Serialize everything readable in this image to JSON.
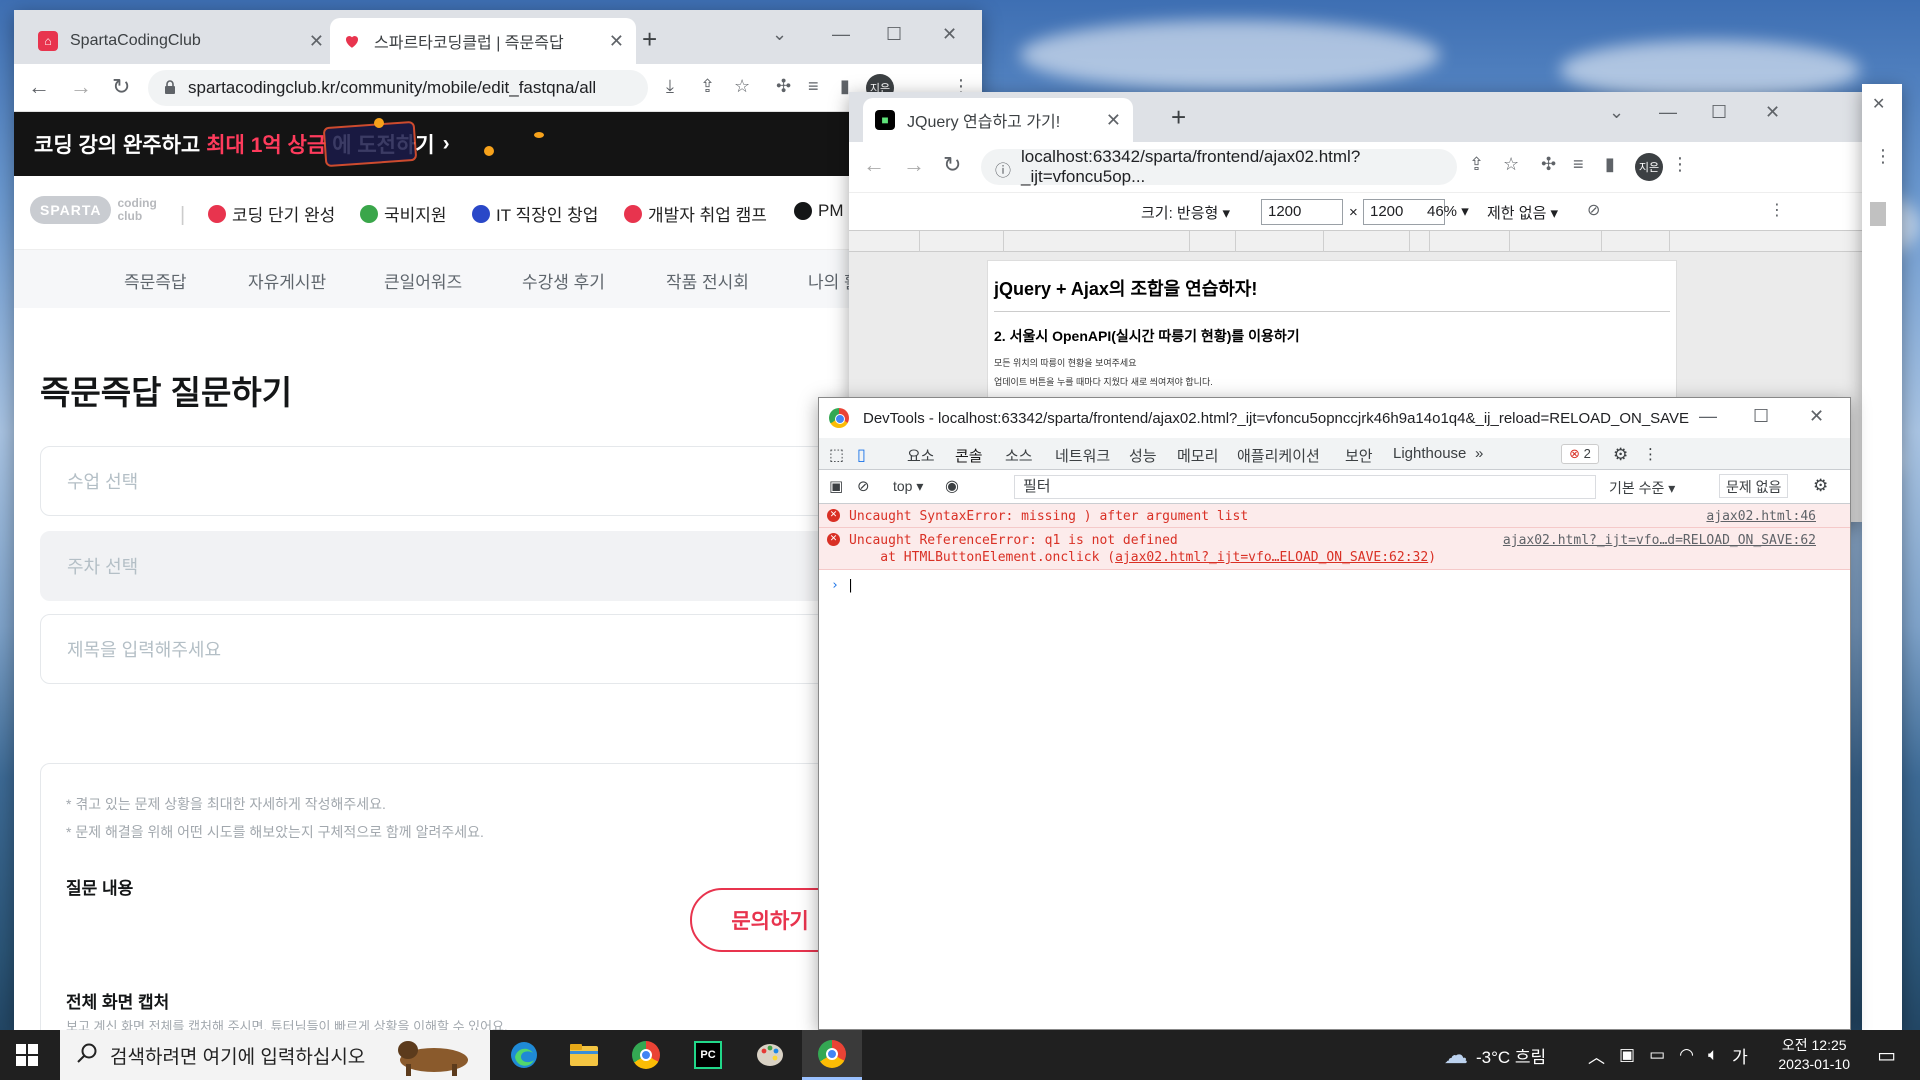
{
  "window1": {
    "tabs": [
      {
        "title": "SpartaCodingClub"
      },
      {
        "title": "스파르타코딩클럽 | 즉문즉답"
      }
    ],
    "url": "spartacodingclub.kr/community/mobile/edit_fastqna/all",
    "profile": "지은",
    "banner": {
      "pre": "코딩 강의 완주하고",
      "highlight": "최대 1억 상금",
      "post": "에 도전하기"
    },
    "logo": {
      "main": "SPARTA",
      "sub1": "coding",
      "sub2": "club"
    },
    "nav": [
      {
        "label": "코딩 단기 완성",
        "color": "#e8344e"
      },
      {
        "label": "국비지원",
        "color": "#3aa64a"
      },
      {
        "label": "IT 직장인 창업",
        "color": "#2a48c8"
      },
      {
        "label": "개발자 취업 캠프",
        "color": "#e8344e"
      },
      {
        "label": "PM",
        "color": "#141617"
      }
    ],
    "subnav": [
      "즉문즉답",
      "자유게시판",
      "큰일어워즈",
      "수강생 후기",
      "작품 전시회",
      "나의 활"
    ],
    "page_title": "즉문즉답 질문하기",
    "fields": {
      "course": "수업 선택",
      "week": "주차 선택",
      "title_placeholder": "제목을 입력해주세요"
    },
    "hints": [
      "* 겪고 있는 문제 상황을 최대한 자세하게 작성해주세요.",
      "* 문제 해결을 위해 어떤 시도를 해보았는지 구체적으로 함께 알려주세요."
    ],
    "question_label": "질문 내용",
    "ask_button": "문의하기",
    "capture_label": "전체 화면 캡처",
    "capture_hint": "보고 계신 화면 전체를 캡처해 주시면, 튜터님들이 빠르게 상황을 이해할 수 있어요."
  },
  "window2": {
    "tab_title": "JQuery 연습하고 가기!",
    "url": "localhost:63342/sparta/frontend/ajax02.html?_ijt=vfoncu5op...",
    "profile": "지은",
    "device_toolbar": {
      "size_label": "크기: 반응형",
      "width": "1200",
      "times": "×",
      "height": "1200",
      "zoom": "46%",
      "throttle": "제한 없음"
    },
    "page": {
      "h1": "jQuery + Ajax의 조합을 연습하자!",
      "h2": "2. 서울시 OpenAPI(실시간 따릉기 현황)를 이용하기",
      "p1": "모든 위치의 따릉이 현황을 보여주세요",
      "p2": "업데이트 버튼을 누를 때마다 지웠다 새로 씌여져야 합니다."
    }
  },
  "devtools": {
    "title": "DevTools - localhost:63342/sparta/frontend/ajax02.html?_ijt=vfoncu5opnccjrk46h9a14o1q4&_ij_reload=RELOAD_ON_SAVE",
    "panels": [
      "요소",
      "콘솔",
      "소스",
      "네트워크",
      "성능",
      "메모리",
      "애플리케이션",
      "보안",
      "Lighthouse",
      "»"
    ],
    "error_count": "2",
    "context": "top",
    "filter_placeholder": "필터",
    "levels": "기본 수준",
    "issues": "문제 없음",
    "messages": [
      {
        "text": "Uncaught SyntaxError: missing ) after argument list",
        "source": "ajax02.html:46"
      },
      {
        "text": "Uncaught ReferenceError: q1 is not defined",
        "source": "ajax02.html?_ijt=vfo…d=RELOAD_ON_SAVE:62",
        "stack_pre": "    at HTMLButtonElement.onclick (",
        "stack_link": "ajax02.html?_ijt=vfo…ELOAD_ON_SAVE:62:32",
        "stack_post": ")"
      }
    ],
    "prompt": "›"
  },
  "taskbar": {
    "search_placeholder": "검색하려면 여기에 입력하십시오",
    "weather": "-3°C 흐림",
    "ime": "가",
    "time": "오전 12:25",
    "date": "2023-01-10"
  },
  "colors": {
    "accent_red": "#e8344e",
    "devtools_error": "#d93025",
    "taskbar": "#202020"
  }
}
